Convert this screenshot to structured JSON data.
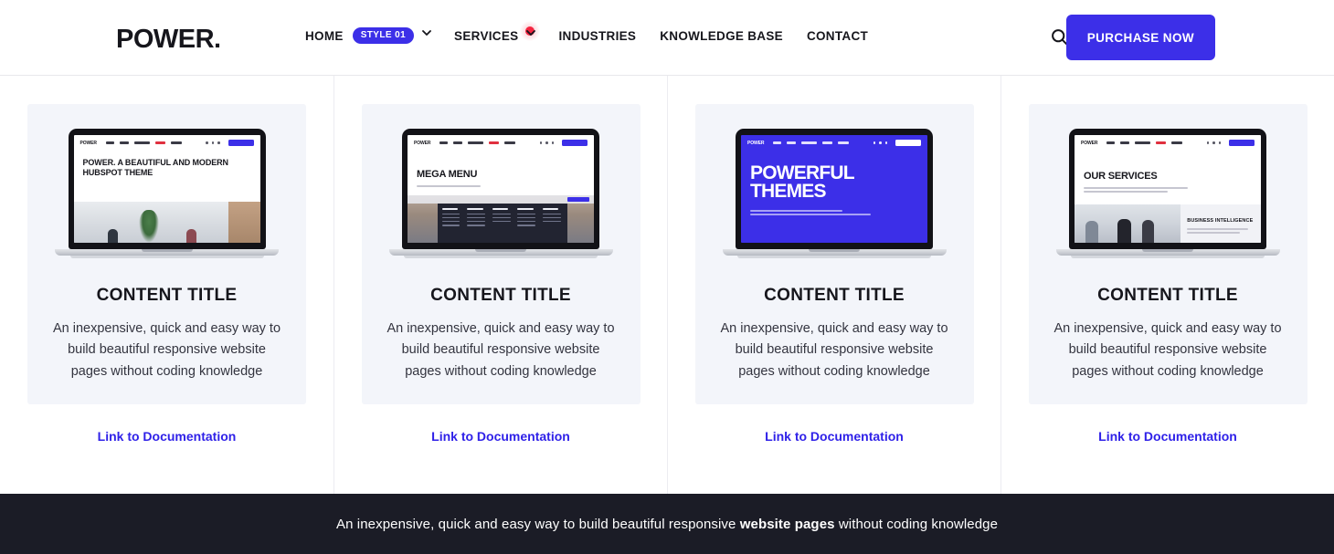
{
  "header": {
    "logo": "POWER.",
    "nav": [
      {
        "label": "HOME",
        "badge": "STYLE 01",
        "has_caret": true,
        "has_dot": false
      },
      {
        "label": "SERVICES",
        "badge": "",
        "has_caret": true,
        "has_dot": true
      },
      {
        "label": "INDUSTRIES",
        "badge": "",
        "has_caret": false,
        "has_dot": false
      },
      {
        "label": "KNOWLEDGE BASE",
        "badge": "",
        "has_caret": false,
        "has_dot": false
      },
      {
        "label": "CONTACT",
        "badge": "",
        "has_caret": false,
        "has_dot": false
      }
    ],
    "search_icon": "search-icon",
    "purchase_label": "PURCHASE NOW",
    "accent_color": "#3c2fe8",
    "dot_color": "#f4243f"
  },
  "cards": [
    {
      "title": "CONTENT TITLE",
      "description": "An inexpensive, quick and easy way to build beautiful responsive website pages without coding knowledge",
      "link": "Link to Documentation",
      "preview": {
        "kind": "hero-photo",
        "mini_logo": "POWER",
        "headline": "POWER. A BEAUTIFUL AND MODERN HUBSPOT THEME",
        "screen_bg": "#ffffff"
      }
    },
    {
      "title": "CONTENT TITLE",
      "description": "An inexpensive, quick and easy way to build beautiful responsive website pages without coding knowledge",
      "link": "Link to Documentation",
      "preview": {
        "kind": "mega-menu",
        "mini_logo": "POWER",
        "headline": "MEGA MENU",
        "screen_bg": "#ffffff"
      }
    },
    {
      "title": "CONTENT TITLE",
      "description": "An inexpensive, quick and easy way to build beautiful responsive website pages without coding knowledge",
      "link": "Link to Documentation",
      "preview": {
        "kind": "blue-hero",
        "mini_logo": "POWER",
        "headline": "POWERFUL THEMES",
        "screen_bg": "#3c2fe8"
      }
    },
    {
      "title": "CONTENT TITLE",
      "description": "An inexpensive, quick and easy way to build beautiful responsive website pages without coding knowledge",
      "link": "Link to Documentation",
      "preview": {
        "kind": "services",
        "mini_logo": "POWER",
        "headline": "OUR SERVICES",
        "sub_label": "BUSINESS INTELLIGENCE",
        "screen_bg": "#ffffff"
      }
    }
  ],
  "footer": {
    "text_before": "An inexpensive, quick and easy way to build beautiful responsive ",
    "text_bold": "website pages",
    "text_after": " without coding knowledge",
    "bg_color": "#1b1c26"
  }
}
